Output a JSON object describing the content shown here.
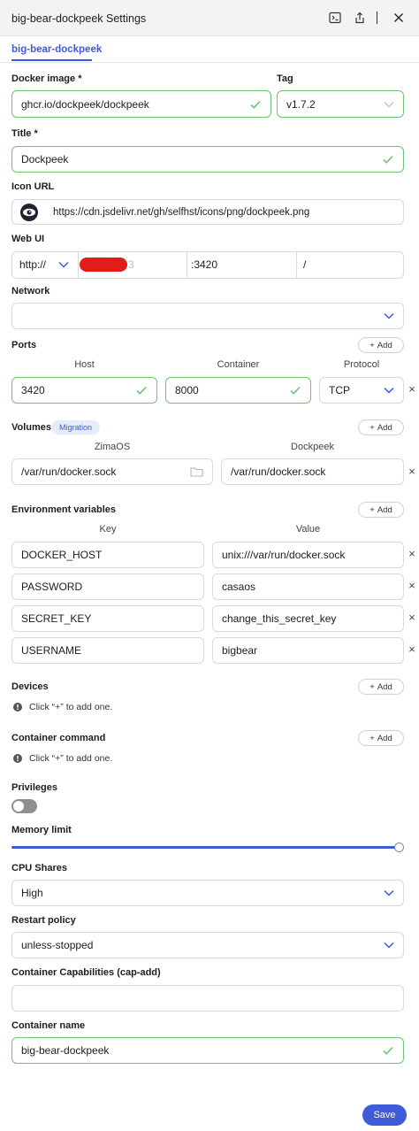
{
  "header": {
    "title": "big-bear-dockpeek Settings"
  },
  "tabs": [
    {
      "label": "big-bear-dockpeek"
    }
  ],
  "docker_image": {
    "label": "Docker image *",
    "value": "ghcr.io/dockpeek/dockpeek"
  },
  "tag": {
    "label": "Tag",
    "value": "v1.7.2"
  },
  "title_field": {
    "label": "Title *",
    "value": "Dockpeek"
  },
  "icon_url": {
    "label": "Icon URL",
    "value": "https://cdn.jsdelivr.net/gh/selfhst/icons/png/dockpeek.png"
  },
  "web_ui": {
    "label": "Web UI",
    "scheme": "http://",
    "host_suffix": "3",
    "port": ":3420",
    "path": "/"
  },
  "network": {
    "label": "Network",
    "value": ""
  },
  "ports": {
    "label": "Ports",
    "add_label": "Add",
    "col_host": "Host",
    "col_container": "Container",
    "col_protocol": "Protocol",
    "rows": [
      {
        "host": "3420",
        "container": "8000",
        "protocol": "TCP"
      }
    ]
  },
  "volumes": {
    "label": "Volumes",
    "badge": "Migration",
    "add_label": "Add",
    "col_host": "ZimaOS",
    "col_container": "Dockpeek",
    "rows": [
      {
        "host": "/var/run/docker.sock",
        "container": "/var/run/docker.sock"
      }
    ]
  },
  "env": {
    "label": "Environment variables",
    "add_label": "Add",
    "col_key": "Key",
    "col_value": "Value",
    "rows": [
      {
        "key": "DOCKER_HOST",
        "value": "unix:///var/run/docker.sock"
      },
      {
        "key": "PASSWORD",
        "value": "casaos"
      },
      {
        "key": "SECRET_KEY",
        "value": "change_this_secret_key"
      },
      {
        "key": "USERNAME",
        "value": "bigbear"
      }
    ]
  },
  "devices": {
    "label": "Devices",
    "add_label": "Add",
    "hint": "Click “+” to add one."
  },
  "container_command": {
    "label": "Container command",
    "add_label": "Add",
    "hint": "Click “+” to add one."
  },
  "privileges": {
    "label": "Privileges",
    "enabled": false
  },
  "memory_limit": {
    "label": "Memory limit",
    "fraction": 1.0
  },
  "cpu_shares": {
    "label": "CPU Shares",
    "value": "High"
  },
  "restart_policy": {
    "label": "Restart policy",
    "value": "unless-stopped"
  },
  "cap_add": {
    "label": "Container Capabilities (cap-add)",
    "value": ""
  },
  "container_name": {
    "label": "Container name",
    "value": "big-bear-dockpeek"
  },
  "save_label": "Save",
  "colors": {
    "accent": "#3f5bd7",
    "valid": "#6cc66f",
    "redaction": "#e21b1b"
  }
}
